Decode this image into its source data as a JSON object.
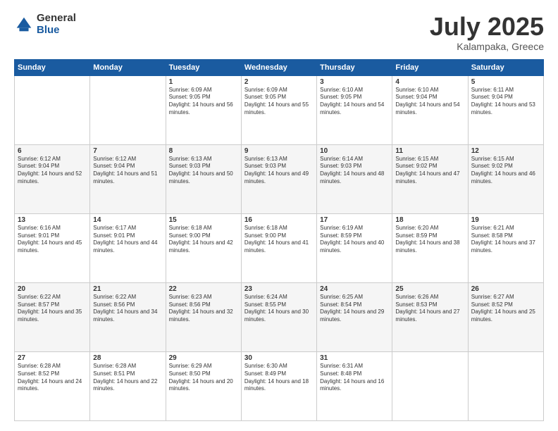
{
  "logo": {
    "general": "General",
    "blue": "Blue"
  },
  "header": {
    "month": "July 2025",
    "location": "Kalampaka, Greece"
  },
  "weekdays": [
    "Sunday",
    "Monday",
    "Tuesday",
    "Wednesday",
    "Thursday",
    "Friday",
    "Saturday"
  ],
  "weeks": [
    [
      {
        "day": "",
        "sunrise": "",
        "sunset": "",
        "daylight": ""
      },
      {
        "day": "",
        "sunrise": "",
        "sunset": "",
        "daylight": ""
      },
      {
        "day": "1",
        "sunrise": "Sunrise: 6:09 AM",
        "sunset": "Sunset: 9:05 PM",
        "daylight": "Daylight: 14 hours and 56 minutes."
      },
      {
        "day": "2",
        "sunrise": "Sunrise: 6:09 AM",
        "sunset": "Sunset: 9:05 PM",
        "daylight": "Daylight: 14 hours and 55 minutes."
      },
      {
        "day": "3",
        "sunrise": "Sunrise: 6:10 AM",
        "sunset": "Sunset: 9:05 PM",
        "daylight": "Daylight: 14 hours and 54 minutes."
      },
      {
        "day": "4",
        "sunrise": "Sunrise: 6:10 AM",
        "sunset": "Sunset: 9:04 PM",
        "daylight": "Daylight: 14 hours and 54 minutes."
      },
      {
        "day": "5",
        "sunrise": "Sunrise: 6:11 AM",
        "sunset": "Sunset: 9:04 PM",
        "daylight": "Daylight: 14 hours and 53 minutes."
      }
    ],
    [
      {
        "day": "6",
        "sunrise": "Sunrise: 6:12 AM",
        "sunset": "Sunset: 9:04 PM",
        "daylight": "Daylight: 14 hours and 52 minutes."
      },
      {
        "day": "7",
        "sunrise": "Sunrise: 6:12 AM",
        "sunset": "Sunset: 9:04 PM",
        "daylight": "Daylight: 14 hours and 51 minutes."
      },
      {
        "day": "8",
        "sunrise": "Sunrise: 6:13 AM",
        "sunset": "Sunset: 9:03 PM",
        "daylight": "Daylight: 14 hours and 50 minutes."
      },
      {
        "day": "9",
        "sunrise": "Sunrise: 6:13 AM",
        "sunset": "Sunset: 9:03 PM",
        "daylight": "Daylight: 14 hours and 49 minutes."
      },
      {
        "day": "10",
        "sunrise": "Sunrise: 6:14 AM",
        "sunset": "Sunset: 9:03 PM",
        "daylight": "Daylight: 14 hours and 48 minutes."
      },
      {
        "day": "11",
        "sunrise": "Sunrise: 6:15 AM",
        "sunset": "Sunset: 9:02 PM",
        "daylight": "Daylight: 14 hours and 47 minutes."
      },
      {
        "day": "12",
        "sunrise": "Sunrise: 6:15 AM",
        "sunset": "Sunset: 9:02 PM",
        "daylight": "Daylight: 14 hours and 46 minutes."
      }
    ],
    [
      {
        "day": "13",
        "sunrise": "Sunrise: 6:16 AM",
        "sunset": "Sunset: 9:01 PM",
        "daylight": "Daylight: 14 hours and 45 minutes."
      },
      {
        "day": "14",
        "sunrise": "Sunrise: 6:17 AM",
        "sunset": "Sunset: 9:01 PM",
        "daylight": "Daylight: 14 hours and 44 minutes."
      },
      {
        "day": "15",
        "sunrise": "Sunrise: 6:18 AM",
        "sunset": "Sunset: 9:00 PM",
        "daylight": "Daylight: 14 hours and 42 minutes."
      },
      {
        "day": "16",
        "sunrise": "Sunrise: 6:18 AM",
        "sunset": "Sunset: 9:00 PM",
        "daylight": "Daylight: 14 hours and 41 minutes."
      },
      {
        "day": "17",
        "sunrise": "Sunrise: 6:19 AM",
        "sunset": "Sunset: 8:59 PM",
        "daylight": "Daylight: 14 hours and 40 minutes."
      },
      {
        "day": "18",
        "sunrise": "Sunrise: 6:20 AM",
        "sunset": "Sunset: 8:59 PM",
        "daylight": "Daylight: 14 hours and 38 minutes."
      },
      {
        "day": "19",
        "sunrise": "Sunrise: 6:21 AM",
        "sunset": "Sunset: 8:58 PM",
        "daylight": "Daylight: 14 hours and 37 minutes."
      }
    ],
    [
      {
        "day": "20",
        "sunrise": "Sunrise: 6:22 AM",
        "sunset": "Sunset: 8:57 PM",
        "daylight": "Daylight: 14 hours and 35 minutes."
      },
      {
        "day": "21",
        "sunrise": "Sunrise: 6:22 AM",
        "sunset": "Sunset: 8:56 PM",
        "daylight": "Daylight: 14 hours and 34 minutes."
      },
      {
        "day": "22",
        "sunrise": "Sunrise: 6:23 AM",
        "sunset": "Sunset: 8:56 PM",
        "daylight": "Daylight: 14 hours and 32 minutes."
      },
      {
        "day": "23",
        "sunrise": "Sunrise: 6:24 AM",
        "sunset": "Sunset: 8:55 PM",
        "daylight": "Daylight: 14 hours and 30 minutes."
      },
      {
        "day": "24",
        "sunrise": "Sunrise: 6:25 AM",
        "sunset": "Sunset: 8:54 PM",
        "daylight": "Daylight: 14 hours and 29 minutes."
      },
      {
        "day": "25",
        "sunrise": "Sunrise: 6:26 AM",
        "sunset": "Sunset: 8:53 PM",
        "daylight": "Daylight: 14 hours and 27 minutes."
      },
      {
        "day": "26",
        "sunrise": "Sunrise: 6:27 AM",
        "sunset": "Sunset: 8:52 PM",
        "daylight": "Daylight: 14 hours and 25 minutes."
      }
    ],
    [
      {
        "day": "27",
        "sunrise": "Sunrise: 6:28 AM",
        "sunset": "Sunset: 8:52 PM",
        "daylight": "Daylight: 14 hours and 24 minutes."
      },
      {
        "day": "28",
        "sunrise": "Sunrise: 6:28 AM",
        "sunset": "Sunset: 8:51 PM",
        "daylight": "Daylight: 14 hours and 22 minutes."
      },
      {
        "day": "29",
        "sunrise": "Sunrise: 6:29 AM",
        "sunset": "Sunset: 8:50 PM",
        "daylight": "Daylight: 14 hours and 20 minutes."
      },
      {
        "day": "30",
        "sunrise": "Sunrise: 6:30 AM",
        "sunset": "Sunset: 8:49 PM",
        "daylight": "Daylight: 14 hours and 18 minutes."
      },
      {
        "day": "31",
        "sunrise": "Sunrise: 6:31 AM",
        "sunset": "Sunset: 8:48 PM",
        "daylight": "Daylight: 14 hours and 16 minutes."
      },
      {
        "day": "",
        "sunrise": "",
        "sunset": "",
        "daylight": ""
      },
      {
        "day": "",
        "sunrise": "",
        "sunset": "",
        "daylight": ""
      }
    ]
  ]
}
